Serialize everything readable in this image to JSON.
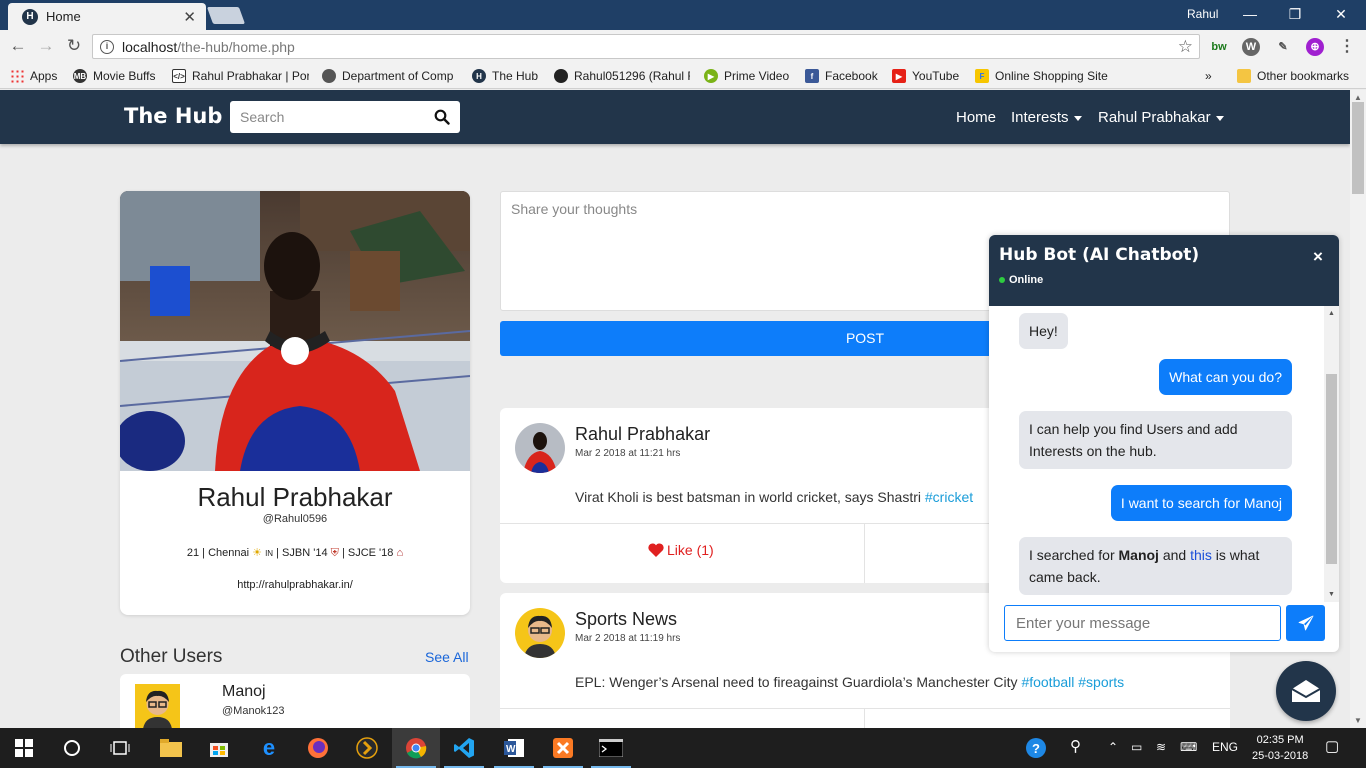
{
  "browser": {
    "tab_title": "Home",
    "tab_favicon": "H",
    "user_name": "Rahul",
    "url_host": "localhost",
    "url_path": "/the-hub/home.php",
    "bookmarks": [
      {
        "label": "Apps",
        "icon": "apps-grid-icon"
      },
      {
        "label": "Movie Buffs",
        "icon": "movie-buffs-icon"
      },
      {
        "label": "Rahul Prabhakar | Por",
        "icon": "code-icon"
      },
      {
        "label": "Department of Comp",
        "icon": "department-icon"
      },
      {
        "label": "The Hub",
        "icon": "hub-icon"
      },
      {
        "label": "Rahul051296 (Rahul F",
        "icon": "github-icon"
      },
      {
        "label": "Prime Video",
        "icon": "prime-video-icon"
      },
      {
        "label": "Facebook",
        "icon": "facebook-icon"
      },
      {
        "label": "YouTube",
        "icon": "youtube-icon"
      },
      {
        "label": "Online Shopping Site",
        "icon": "shopping-icon"
      }
    ],
    "more_bookmarks": "»",
    "other_bookmarks": "Other bookmarks"
  },
  "nav": {
    "brand": "The Hub",
    "search_placeholder": "Search",
    "home": "Home",
    "interests": "Interests",
    "user": "Rahul Prabhakar"
  },
  "profile": {
    "name": "Rahul Prabhakar",
    "handle": "@Rahul0596",
    "bio_prefix": "21 | Chennai",
    "bio_flag": "IN",
    "bio_school1": "| SJBN '14",
    "bio_school2": "| SJCE '18",
    "website": "http://rahulprabhakar.in/"
  },
  "others": {
    "title": "Other Users",
    "see_all": "See All",
    "users": [
      {
        "name": "Manoj",
        "handle": "@Manok123"
      }
    ]
  },
  "composer": {
    "placeholder": "Share your thoughts",
    "post_button": "POST"
  },
  "posts": [
    {
      "author": "Rahul Prabhakar",
      "date": "Mar 2 2018 at 11:21 hrs",
      "text": "Virat Kholi is best batsman in world cricket, says Shastri ",
      "tags": [
        "#cricket"
      ],
      "like_label": "Like (1)"
    },
    {
      "author": "Sports News",
      "date": "Mar 2 2018 at 11:19 hrs",
      "text": "EPL: Wenger’s Arsenal need to fireagainst Guardiola’s Manchester City ",
      "tags": [
        "#football",
        "#sports"
      ]
    }
  ],
  "chat": {
    "title": "Hub Bot (AI Chatbot)",
    "status": "Online",
    "close": "×",
    "messages": [
      {
        "from": "bot",
        "text": "Hey!"
      },
      {
        "from": "me",
        "text": "What can you do?"
      },
      {
        "from": "bot",
        "text": "I can help you find Users and add Interests on the hub."
      },
      {
        "from": "me",
        "text": "I want to search for Manoj"
      },
      {
        "from": "bot",
        "text_a": "I searched for ",
        "bold": "Manoj",
        "text_b": " and ",
        "link": "this",
        "text_c": " is what came back."
      }
    ],
    "input_placeholder": "Enter your message"
  },
  "taskbar": {
    "language": "ENG",
    "time": "02:35 PM",
    "date": "25-03-2018"
  },
  "colors": {
    "navy": "#22354a",
    "accent_blue": "#0d7dfa",
    "tag_blue": "#1a9dd9",
    "like_red": "#e02020"
  }
}
